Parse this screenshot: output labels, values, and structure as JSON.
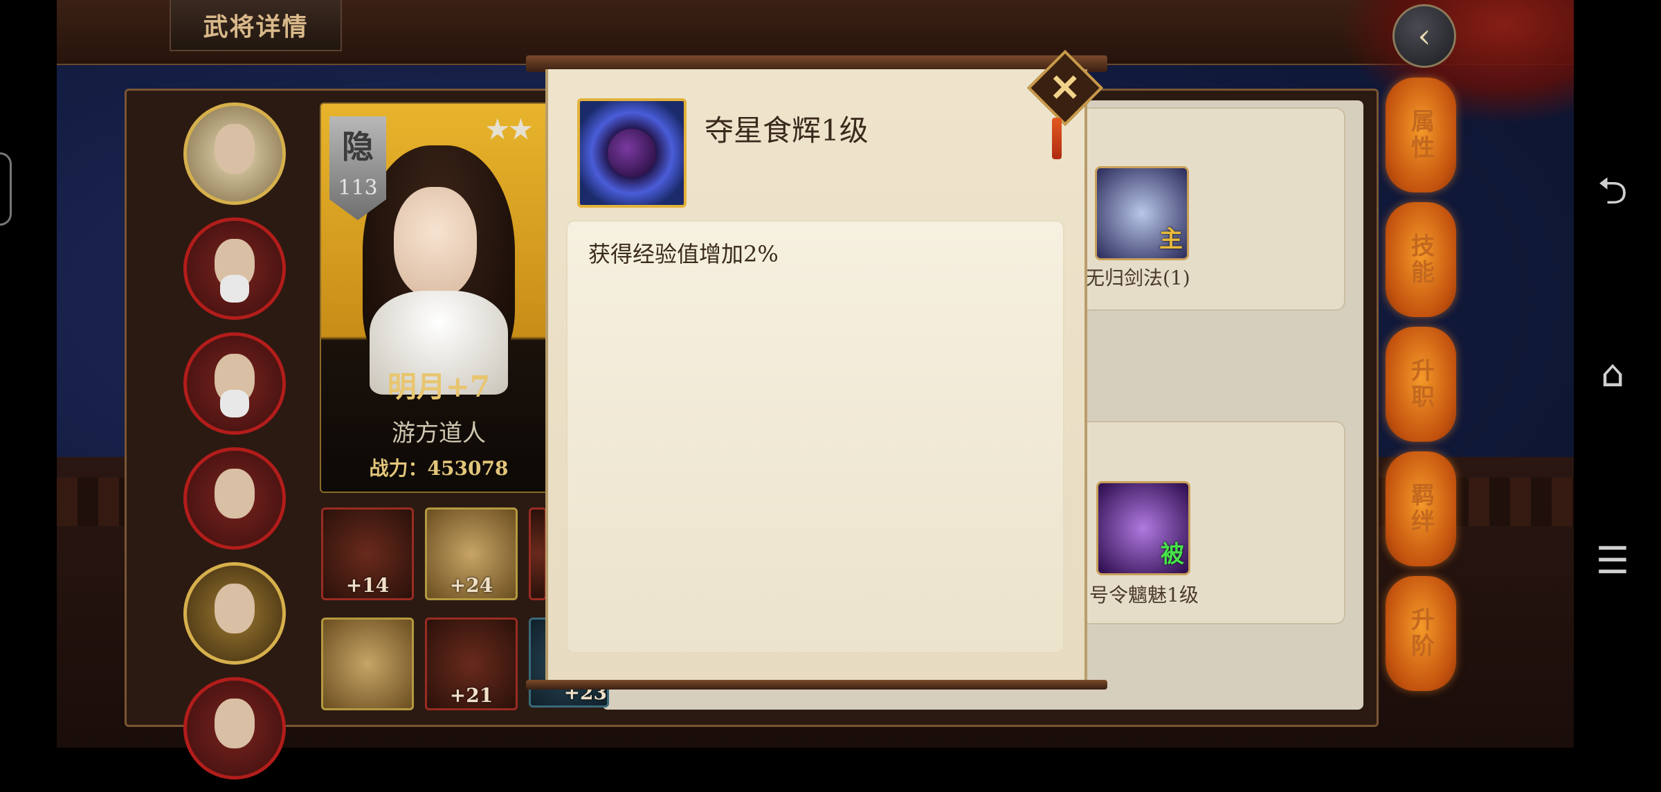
{
  "header": {
    "title": "武将详情",
    "back_icon": "chevron-left-icon"
  },
  "hero": {
    "rank_glyph": "隐",
    "rank_number": "113",
    "name": "明月+7",
    "class": "游方道人",
    "power_label": "战力：",
    "power_value": "453078",
    "stars": "★★"
  },
  "roster": [
    {
      "name": "roster-hero-1"
    },
    {
      "name": "roster-hero-2"
    },
    {
      "name": "roster-hero-3"
    },
    {
      "name": "roster-hero-4"
    },
    {
      "name": "roster-hero-5"
    },
    {
      "name": "roster-hero-6"
    }
  ],
  "equipment": [
    "+14",
    "+24",
    "",
    "+21",
    "+23"
  ],
  "skills": {
    "active": "无归剑法(1)",
    "active_tag": "主",
    "passive": "号令魑魅1级",
    "passive_tag": "被"
  },
  "side_tabs": [
    "属性",
    "技能",
    "升职",
    "羁绊",
    "升阶"
  ],
  "modal": {
    "title": "夺星食辉1级",
    "description": "获得经验值增加2%",
    "close_icon": "close-icon"
  },
  "system_nav": {
    "back": "⮌",
    "home": "⌂",
    "menu": "☰"
  }
}
